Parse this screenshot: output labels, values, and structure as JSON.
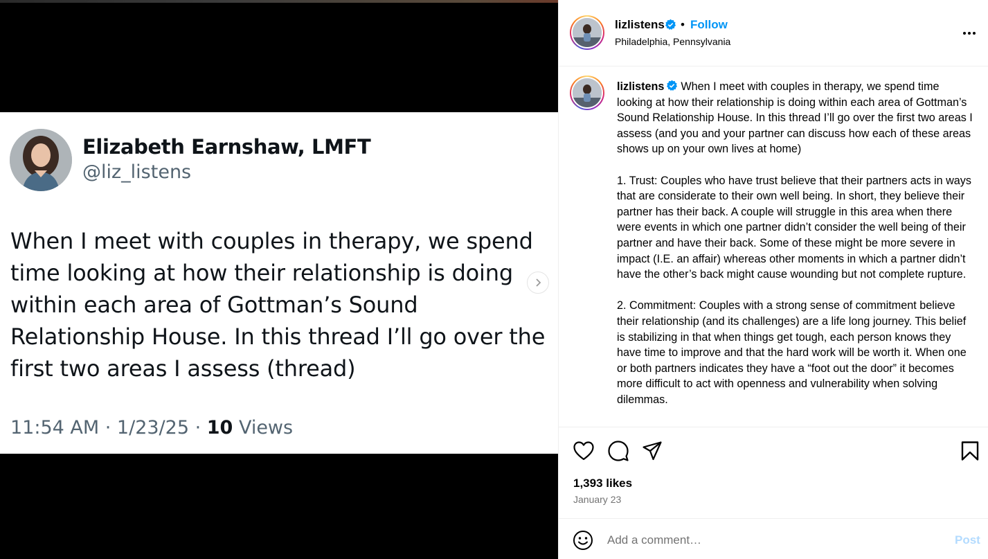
{
  "tweet": {
    "name": "Elizabeth Earnshaw, LMFT",
    "handle": "@liz_listens",
    "text": "When I meet with couples in therapy, we spend time looking at how their relationship is doing within each area of Gottman’s Sound Relationship House. In this thread I’ll go over the first two areas I assess (thread)",
    "time": "11:54 AM",
    "date": "1/23/25",
    "views_count": "10",
    "views_label": "Views"
  },
  "header": {
    "username": "lizlistens",
    "separator": "•",
    "follow_label": "Follow",
    "location": "Philadelphia, Pennsylvania"
  },
  "caption": {
    "username": "lizlistens",
    "text": "When I meet with couples in therapy, we spend time looking at how their relationship is doing within each area of Gottman’s Sound Relationship House. In this thread I’ll go over the first two areas I assess (and you and your partner can discuss how each of these areas shows up on your own lives at home)\n\n1. Trust: Couples who have trust believe that their partners acts in ways that are considerate to their own well being. In short, they believe their partner has their back. A couple will struggle in this area when there were events in which one partner didn’t consider the well being of their partner and have their back. Some of these might be more severe in impact (I.E. an affair) whereas other moments in which a partner didn’t have the other’s back might cause wounding but not complete rupture.\n\n2. Commitment: Couples with a strong sense of commitment believe their relationship (and its challenges) are a life long journey. This belief is stabilizing in that when things get tough, each person knows they have time to improve and that the hard work will be worth it. When one or both partners indicates they have a “foot out the door” it becomes more difficult to act with openness and vulnerability when solving dilemmas."
  },
  "engagement": {
    "likes": "1,393 likes",
    "date": "January 23"
  },
  "comment": {
    "placeholder": "Add a comment…",
    "post_label": "Post"
  },
  "colors": {
    "follow": "#0095f6",
    "verified": "#0095f6",
    "post_disabled": "#b3dbff"
  },
  "icons": [
    "verified-icon",
    "more-options-icon",
    "heart-icon",
    "comment-icon",
    "share-icon",
    "bookmark-icon",
    "emoji-icon",
    "chevron-right-icon"
  ]
}
